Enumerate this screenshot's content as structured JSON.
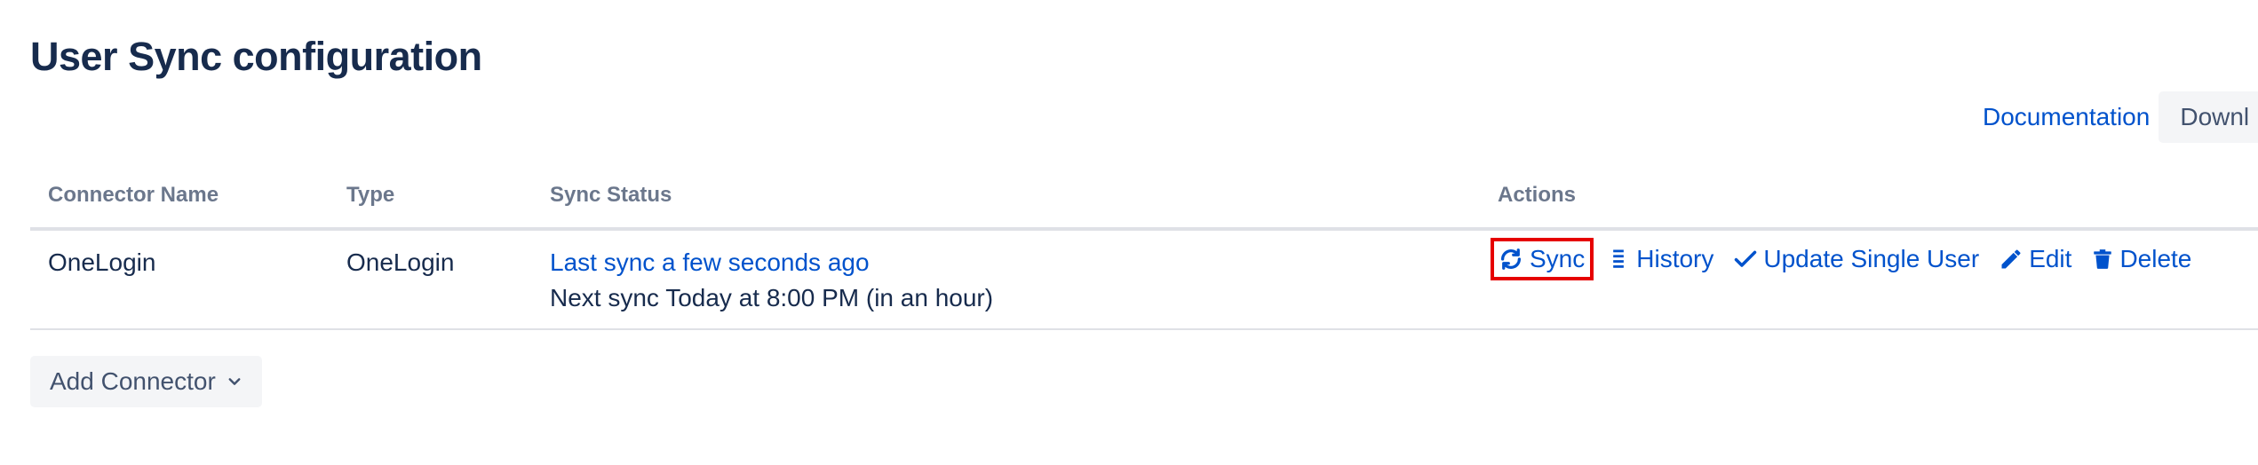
{
  "page": {
    "title": "User Sync configuration"
  },
  "top_actions": {
    "documentation_label": "Documentation",
    "download_label": "Downl"
  },
  "table": {
    "headers": [
      "Connector Name",
      "Type",
      "Sync Status",
      "Actions"
    ],
    "rows": [
      {
        "connector_name": "OneLogin",
        "type": "OneLogin",
        "last_sync": "Last sync a few seconds ago",
        "next_sync": "Next sync Today at 8:00 PM (in an hour)",
        "actions": {
          "sync": "Sync",
          "history": "History",
          "update_single_user": "Update Single User",
          "edit": "Edit",
          "delete": "Delete"
        }
      }
    ]
  },
  "add_connector": {
    "label": "Add Connector"
  },
  "icons": {
    "sync": "sync-icon",
    "history": "list-icon",
    "update_single_user": "checkmark-icon",
    "edit": "pencil-icon",
    "delete": "trash-icon",
    "add_connector": "chevron-down-icon"
  },
  "colors": {
    "link": "#0052cc",
    "title": "#172b4d",
    "header_text": "#6b778c",
    "highlight_box": "#e60000",
    "button_bg": "#f4f5f7"
  }
}
